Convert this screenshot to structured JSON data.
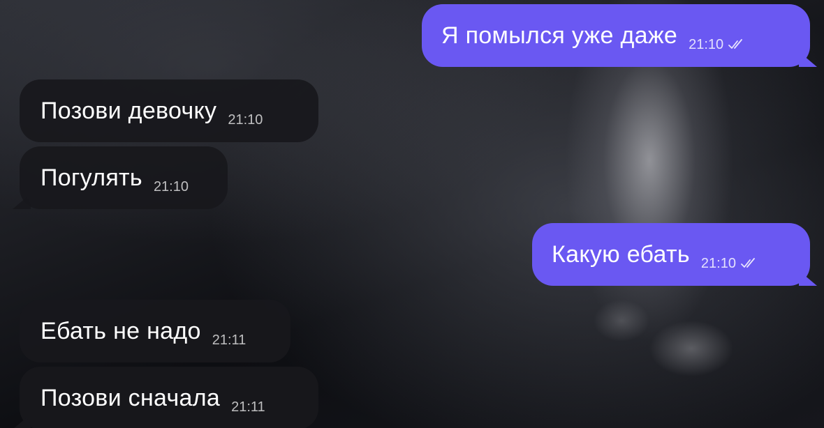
{
  "messages": [
    {
      "direction": "outgoing",
      "text": "Я помылся уже даже",
      "time": "21:10",
      "status_icon": "double-check-icon"
    },
    {
      "direction": "incoming",
      "text": "Позови девочку",
      "time": "21:10"
    },
    {
      "direction": "incoming",
      "text": "Погулять",
      "time": "21:10"
    },
    {
      "direction": "outgoing",
      "text": "Какую ебать",
      "time": "21:10",
      "status_icon": "double-check-icon"
    },
    {
      "direction": "incoming",
      "text": "Ебать не надо",
      "time": "21:11"
    },
    {
      "direction": "incoming",
      "text": "Позови сначала",
      "time": "21:11"
    }
  ],
  "colors": {
    "outgoing_bubble": "#6a58f2",
    "incoming_bubble": "#18181c",
    "text": "#ffffff"
  }
}
